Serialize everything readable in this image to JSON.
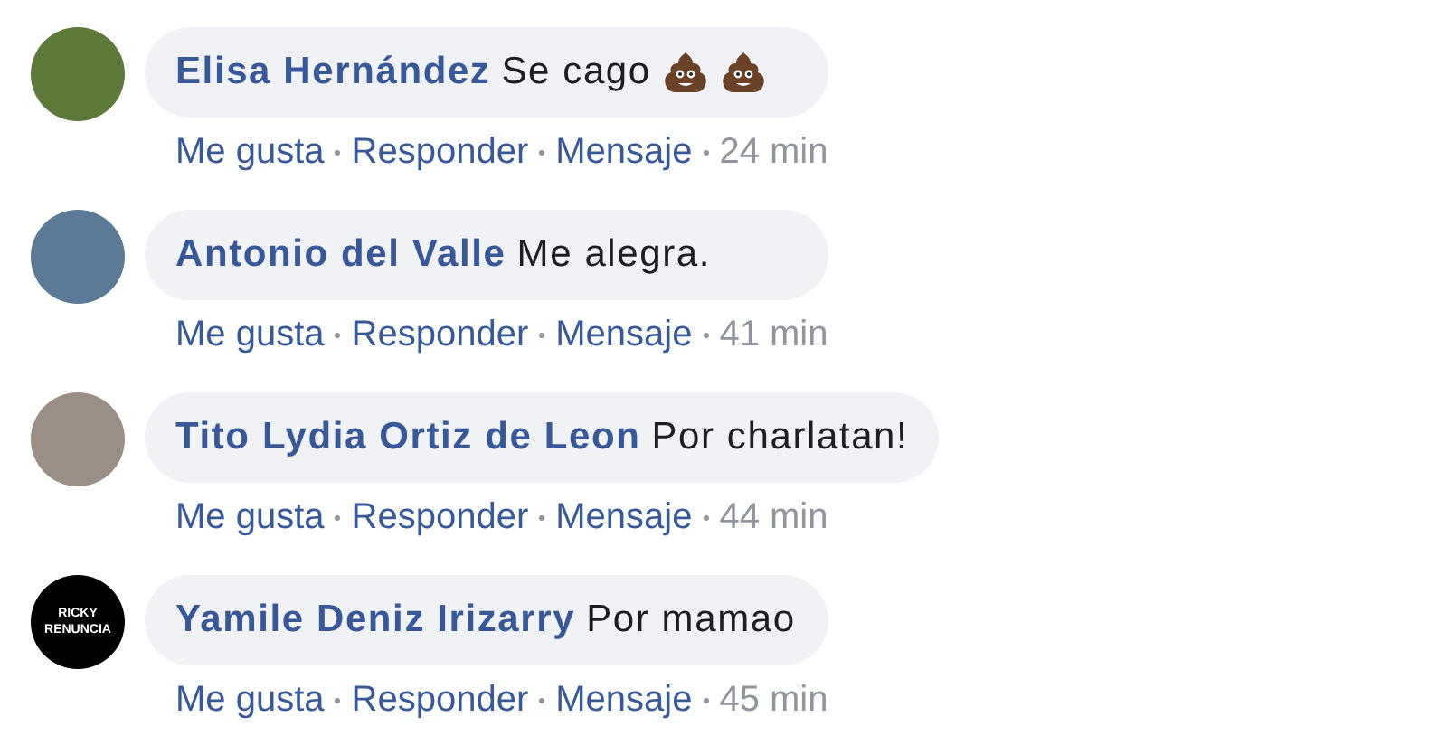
{
  "comments": [
    {
      "avatar": {
        "kind": "photo",
        "color": "#5e7a3a"
      },
      "author": "Elisa Hernández",
      "text": "Se cago",
      "emojis": [
        {
          "kind": "poop"
        },
        {
          "kind": "poop"
        }
      ],
      "actions": [
        "Me gusta",
        "Responder",
        "Mensaje"
      ],
      "time": "24 min"
    },
    {
      "avatar": {
        "kind": "photo",
        "color": "#5a7a96"
      },
      "author": "Antonio del Valle",
      "text": "Me alegra.",
      "actions": [
        "Me gusta",
        "Responder",
        "Mensaje"
      ],
      "time": "41 min"
    },
    {
      "avatar": {
        "kind": "photo",
        "color": "#9a8f86"
      },
      "author": "Tito Lydia Ortiz de Leon",
      "text": "Por charlatan!",
      "actions": [
        "Me gusta",
        "Responder",
        "Mensaje"
      ],
      "time": "44 min"
    },
    {
      "avatar": {
        "kind": "text",
        "color": "#000000",
        "lines": [
          "RICKY",
          "RENUNCIA"
        ]
      },
      "author": "Yamile Deniz Irizarry",
      "text": "Por mamao",
      "actions": [
        "Me gusta",
        "Responder",
        "Mensaje"
      ],
      "time": "45 min"
    }
  ]
}
